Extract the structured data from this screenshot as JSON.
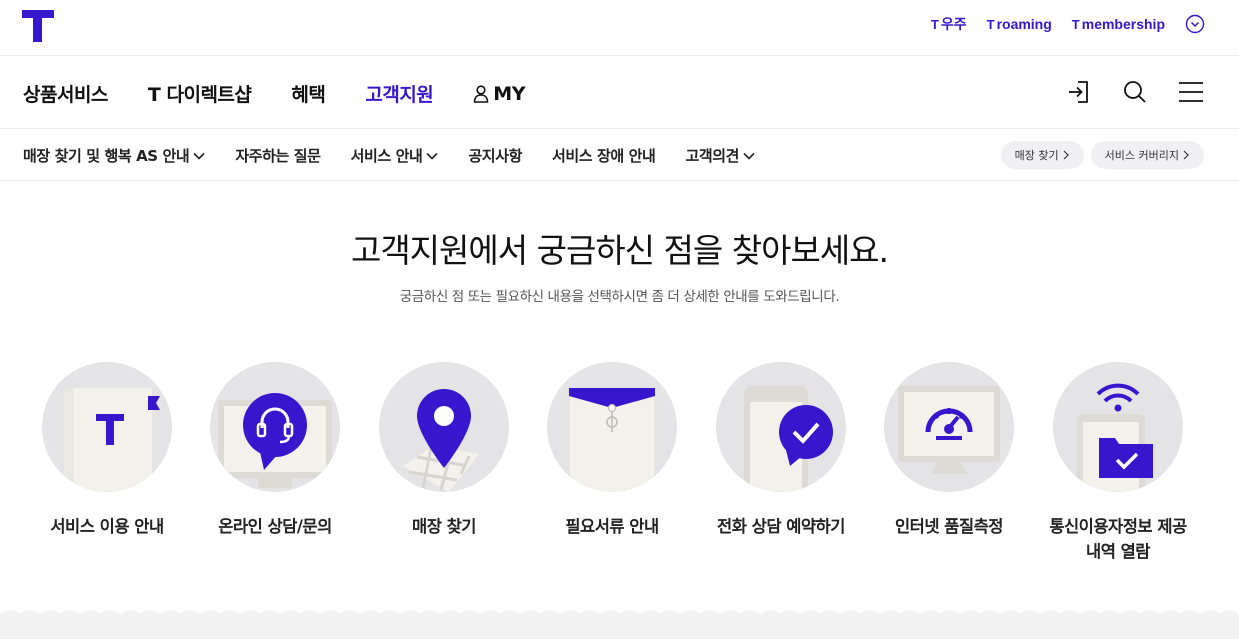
{
  "header": {
    "util_links": [
      {
        "mark": "T",
        "label": "우주"
      },
      {
        "mark": "T",
        "label": "roaming"
      },
      {
        "mark": "T",
        "label": "membership"
      }
    ]
  },
  "gnb": {
    "items": [
      {
        "label": "상품서비스"
      },
      {
        "label": "T 다이렉트샵"
      },
      {
        "label": "혜택"
      },
      {
        "label": "고객지원"
      },
      {
        "label": "MY"
      }
    ]
  },
  "lnb": {
    "items": [
      {
        "label": "매장 찾기 및 행복 AS 안내"
      },
      {
        "label": "자주하는 질문"
      },
      {
        "label": "서비스 안내"
      },
      {
        "label": "공지사항"
      },
      {
        "label": "서비스 장애 안내"
      },
      {
        "label": "고객의견"
      }
    ],
    "quick_buttons": [
      {
        "label": "매장 찾기"
      },
      {
        "label": "서비스 커버리지"
      }
    ]
  },
  "hero": {
    "title": "고객지원에서 궁금하신 점을 찾아보세요.",
    "description": "궁금하신 점 또는 필요하신 내용을 선택하시면 좀 더 상세한 안내를 도와드립니다."
  },
  "cards": [
    {
      "label": "서비스 이용 안내",
      "icon": "book-icon"
    },
    {
      "label": "온라인 상담/문의",
      "icon": "headset-chat-icon"
    },
    {
      "label": "매장 찾기",
      "icon": "map-pin-icon"
    },
    {
      "label": "필요서류 안내",
      "icon": "document-envelope-icon"
    },
    {
      "label": "전화 상담 예약하기",
      "icon": "phone-check-icon"
    },
    {
      "label": "인터넷 품질측정",
      "icon": "speedometer-monitor-icon"
    },
    {
      "label": "통신이용자정보 제공\n내역 열람",
      "icon": "wifi-folder-icon"
    }
  ],
  "colors": {
    "brand": "#3617ce",
    "circle_bg": "#e4e4e6",
    "paper": "#f2f1ec"
  }
}
